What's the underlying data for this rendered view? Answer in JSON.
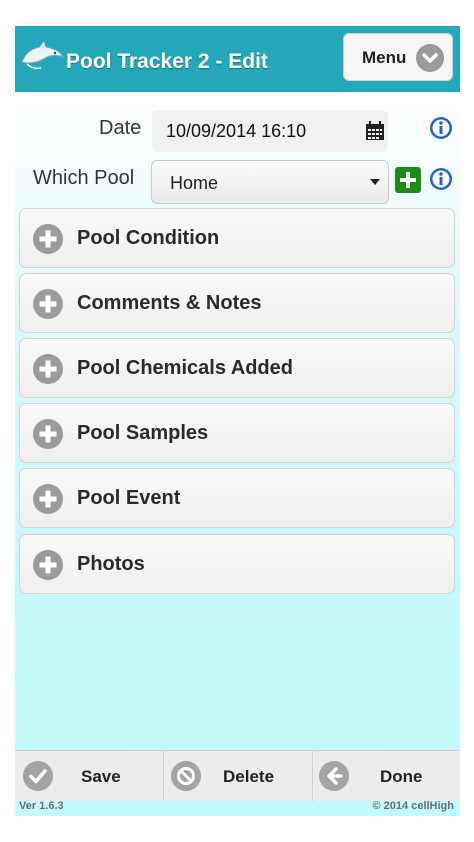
{
  "header": {
    "title": "Pool Tracker 2 - Edit",
    "menu_label": "Menu"
  },
  "form": {
    "date_label": "Date",
    "date_value": "10/09/2014 16:10",
    "pool_label": "Which Pool",
    "pool_selected": "Home"
  },
  "sections": [
    {
      "label": "Pool Condition"
    },
    {
      "label": "Comments & Notes"
    },
    {
      "label": "Pool Chemicals Added"
    },
    {
      "label": "Pool Samples"
    },
    {
      "label": "Pool Event"
    },
    {
      "label": "Photos"
    }
  ],
  "footer": {
    "save_label": "Save",
    "delete_label": "Delete",
    "done_label": "Done"
  },
  "version": "Ver 1.6.3",
  "copyright": "© 2014 cellHigh",
  "colors": {
    "header": "#24a8b9",
    "info_icon": "#1e67c8",
    "add_button": "#1a8d1a"
  }
}
